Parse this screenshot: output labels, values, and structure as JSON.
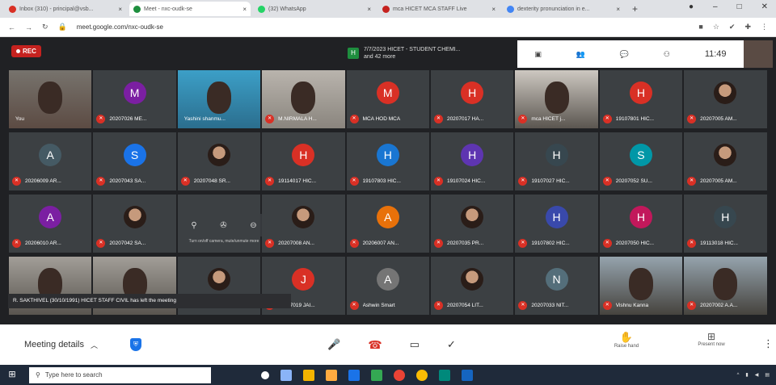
{
  "browser": {
    "tabs": [
      {
        "title": "Inbox (310) - principal@vsb...",
        "color": "#d93025",
        "active": false
      },
      {
        "title": "Meet - nxc-oudk-se",
        "color": "#1e8e3e",
        "active": true
      },
      {
        "title": "(32) WhatsApp",
        "color": "#25d366",
        "active": false
      },
      {
        "title": "mca HICET MCA STAFF Live",
        "color": "#c5221f",
        "active": false
      },
      {
        "title": "dexterity pronunciation in e...",
        "color": "#4285f4",
        "active": false
      }
    ],
    "url": "meet.google.com/nxc-oudk-se"
  },
  "meet": {
    "rec_label": "REC",
    "chat_title": "7/7/2023 HICET - STUDENT CHEMI...",
    "chat_sub": "and 42 more",
    "time": "11:49",
    "toast": "R. SAKTHIVEL (30/10/1991) HICET STAFF CIVIL has left the meeting",
    "hover_tip": "Turn on/off camera, mute/unmute more",
    "tiles": [
      {
        "kind": "video",
        "variant": "v1",
        "name": "You",
        "mic": false
      },
      {
        "kind": "avatar",
        "letter": "M",
        "color": "#7b1fa2",
        "name": "20207026 ME...",
        "mic": true
      },
      {
        "kind": "video",
        "variant": "v2",
        "name": "Yashini shanmu...",
        "mic": false
      },
      {
        "kind": "video",
        "variant": "v3",
        "name": "M.NIRMALA H...",
        "mic": true
      },
      {
        "kind": "avatar",
        "letter": "M",
        "color": "#d93025",
        "name": "MCA HOD MCA",
        "mic": true
      },
      {
        "kind": "avatar",
        "letter": "H",
        "color": "#d93025",
        "name": "20207017 HA...",
        "mic": true
      },
      {
        "kind": "video",
        "variant": "v4",
        "name": "mca HICET j...",
        "mic": true
      },
      {
        "kind": "avatar",
        "letter": "H",
        "color": "#d93025",
        "name": "19107801 HIC...",
        "mic": true
      },
      {
        "kind": "image",
        "name": "20207005 AM...",
        "mic": true
      },
      {
        "kind": "avatar",
        "letter": "A",
        "color": "#455a64",
        "name": "20206009 AR...",
        "mic": true
      },
      {
        "kind": "avatar",
        "letter": "S",
        "color": "#1a73e8",
        "name": "20207043 SA...",
        "mic": true
      },
      {
        "kind": "image",
        "name": "20207048 SR...",
        "mic": true
      },
      {
        "kind": "avatar",
        "letter": "H",
        "color": "#d93025",
        "name": "19114017 HIC...",
        "mic": true
      },
      {
        "kind": "avatar",
        "letter": "H",
        "color": "#1976d2",
        "name": "19107803 HIC...",
        "mic": true
      },
      {
        "kind": "avatar",
        "letter": "H",
        "color": "#5e35b1",
        "name": "19107024 HIC...",
        "mic": true
      },
      {
        "kind": "avatar",
        "letter": "H",
        "color": "#37474f",
        "name": "19107027 HIC...",
        "mic": true
      },
      {
        "kind": "avatar",
        "letter": "S",
        "color": "#0097a7",
        "name": "20207052 SU...",
        "mic": true
      },
      {
        "kind": "image",
        "name": "20207005 AM...",
        "mic": true
      },
      {
        "kind": "avatar",
        "letter": "A",
        "color": "#7b1fa2",
        "name": "20206010 AR...",
        "mic": true
      },
      {
        "kind": "image",
        "name": "20207042 SA...",
        "mic": true
      },
      {
        "kind": "blank",
        "name": "",
        "mic": false
      },
      {
        "kind": "image",
        "name": "20207008 AN...",
        "mic": true
      },
      {
        "kind": "avatar",
        "letter": "A",
        "color": "#e8710a",
        "name": "20206007 AN...",
        "mic": true
      },
      {
        "kind": "image",
        "name": "20207035 PR...",
        "mic": true
      },
      {
        "kind": "avatar",
        "letter": "H",
        "color": "#3949ab",
        "name": "19107802 HIC...",
        "mic": true
      },
      {
        "kind": "avatar",
        "letter": "H",
        "color": "#c2185b",
        "name": "20207050 HIC...",
        "mic": true
      },
      {
        "kind": "avatar",
        "letter": "H",
        "color": "#37474f",
        "name": "19113018 HIC...",
        "mic": true
      },
      {
        "kind": "video",
        "variant": "v5",
        "name": "",
        "mic": false
      },
      {
        "kind": "video",
        "variant": "v5",
        "name": "",
        "mic": false
      },
      {
        "kind": "image",
        "name": "",
        "mic": false
      },
      {
        "kind": "avatar",
        "letter": "J",
        "color": "#d93025",
        "name": "20207019 JAI...",
        "mic": true
      },
      {
        "kind": "avatar",
        "letter": "A",
        "color": "#757575",
        "name": "Ashwin Smart",
        "mic": true
      },
      {
        "kind": "image",
        "name": "20207054 LIT...",
        "mic": true
      },
      {
        "kind": "avatar",
        "letter": "N",
        "color": "#546e7a",
        "name": "20207033 NIT...",
        "mic": true
      },
      {
        "kind": "video",
        "variant": "v6",
        "name": "Vishnu Kanna",
        "mic": true
      },
      {
        "kind": "video",
        "variant": "v6",
        "name": "20207002 A.A...",
        "mic": true
      }
    ]
  },
  "bottom": {
    "meeting_details": "Meeting details",
    "raise_hand": "Raise hand",
    "present_now": "Present now"
  },
  "taskbar": {
    "search_placeholder": "Type here to search"
  }
}
